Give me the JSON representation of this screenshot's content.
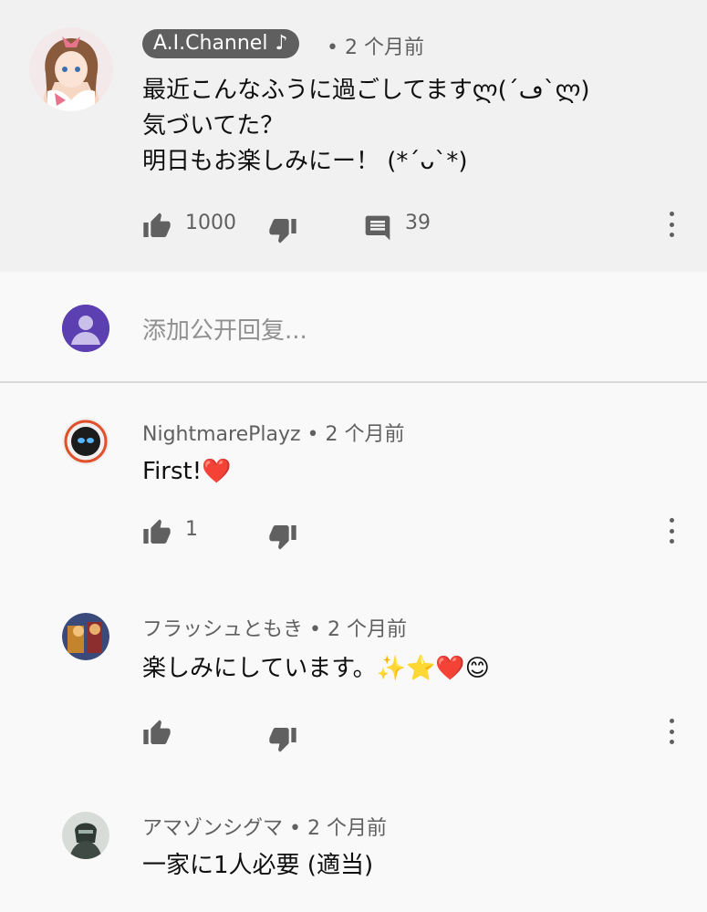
{
  "main_comment": {
    "channel": "A.I.Channel",
    "badge_icon": "music-note-icon",
    "time": "• 2 个月前",
    "lines": [
      "最近こんなふうに過ごしてますლ(´ڡ`ლ)",
      "気づいてた？",
      "明日もお楽しみにー！ (*´ᴗ`*)"
    ],
    "likes": "1000",
    "replies_count": "39"
  },
  "reply_input": {
    "placeholder": "添加公开回复..."
  },
  "replies": [
    {
      "author": "NightmarePlayz • 2 个月前",
      "text": "First!❤️",
      "likes": "1"
    },
    {
      "author": "フラッシュともき • 2 个月前",
      "text": "楽しみにしています。✨⭐❤️😊",
      "likes": ""
    },
    {
      "author": "アマゾンシグマ • 2 个月前",
      "text": "一家に1人必要 (適当)",
      "likes": ""
    }
  ],
  "colors": {
    "main_bg": "#f1f1f1",
    "page_bg": "#f9f9f9",
    "badge_bg": "#5f5f5f",
    "icon_gray": "#606060",
    "reply_avatar": "#5c3fb0"
  }
}
